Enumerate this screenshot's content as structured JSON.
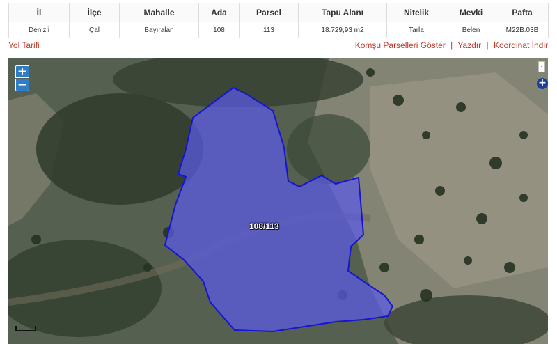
{
  "table": {
    "headers": [
      "İl",
      "İlçe",
      "Mahalle",
      "Ada",
      "Parsel",
      "Tapu Alanı",
      "Nitelik",
      "Mevki",
      "Pafta"
    ],
    "row": [
      "Denizli",
      "Çal",
      "Bayıralan",
      "108",
      "113",
      "18.729,93 m2",
      "Tarla",
      "Belen",
      "M22B.03B"
    ]
  },
  "links": {
    "route": "Yol Tarifi",
    "neighbors": "Komşu Parselleri Göster",
    "print": "Yazdır",
    "coordinates": "Koordinat İndir",
    "separator": "|"
  },
  "map": {
    "zoom_in": "+",
    "zoom_out": "−",
    "layer_toggle": "-",
    "layer_plus": "+",
    "parcel_label": "108/113",
    "parcel_fill": "#5a5ae6",
    "parcel_stroke": "#1414d2"
  }
}
